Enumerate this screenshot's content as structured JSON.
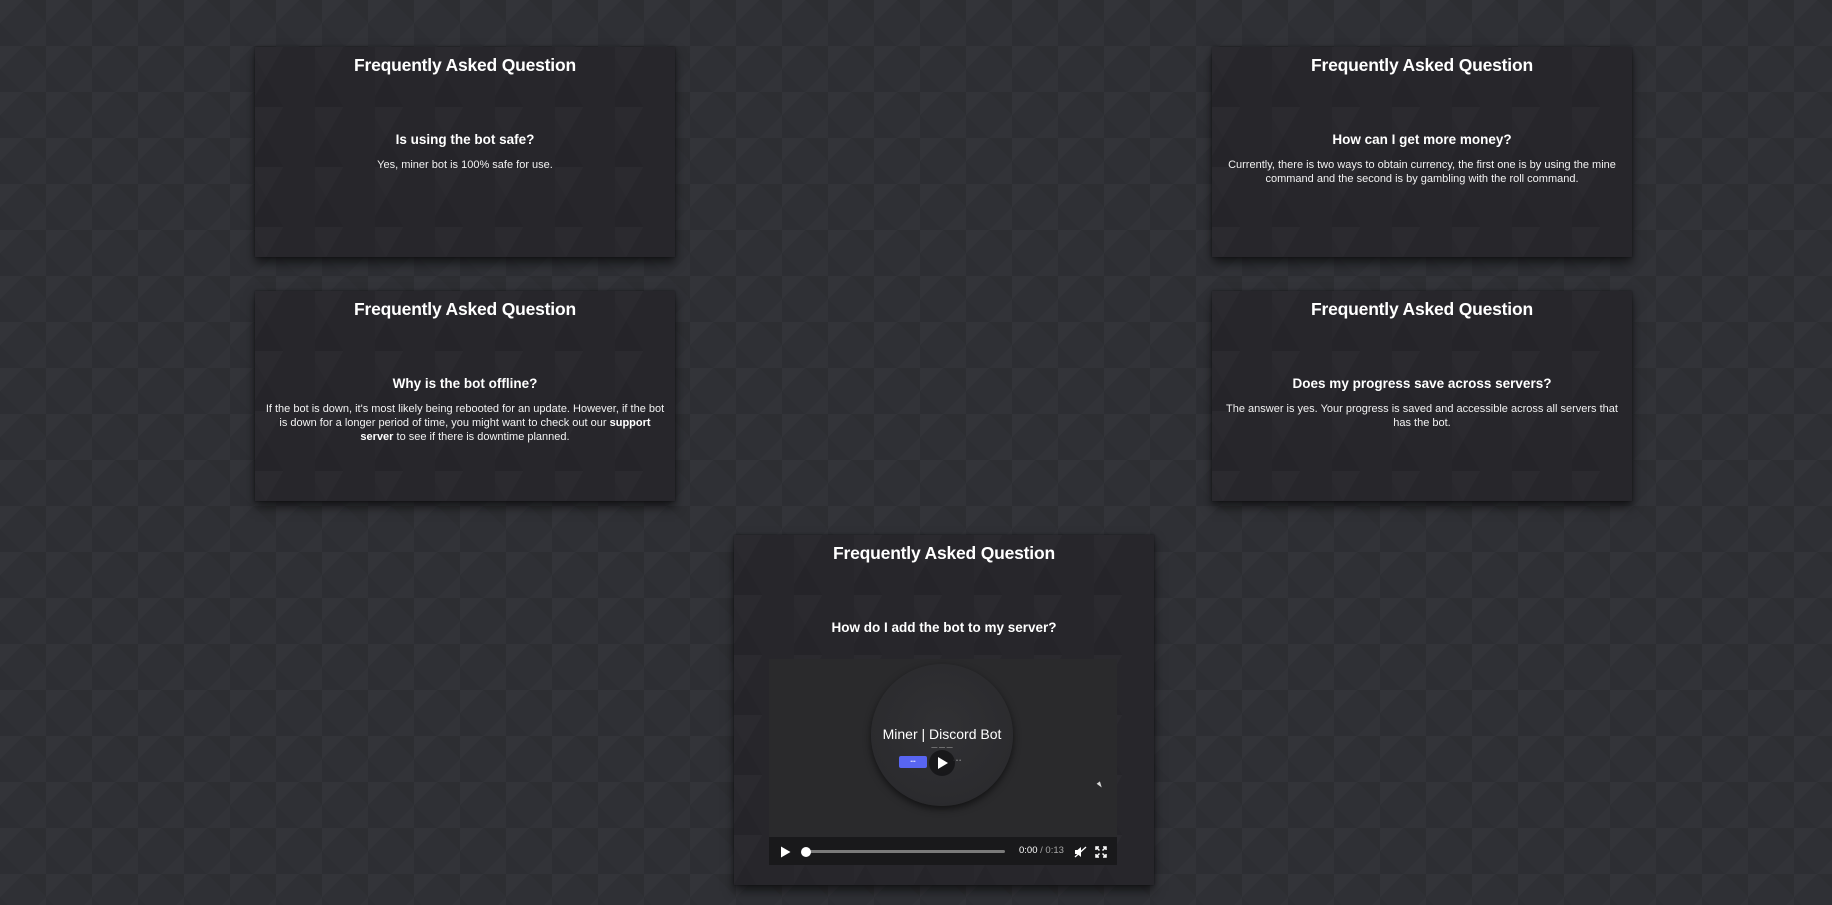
{
  "faq_cards": [
    {
      "title": "Frequently Asked Question",
      "question": "Is using the bot safe?",
      "answer": "Yes, miner bot is 100% safe for use."
    },
    {
      "title": "Frequently Asked Question",
      "question": "How can I get more money?",
      "answer": "Currently, there is two ways to obtain currency, the first one is by using the mine command and the second is by gambling with the roll command."
    },
    {
      "title": "Frequently Asked Question",
      "question": "Why is the bot offline?",
      "answer_before_link": "If the bot is down, it's most likely being rebooted for an update. However, if the bot is down for a longer period of time, you might want to check out our",
      "answer_link": "support server",
      "answer_after_link": "to see if there is downtime planned."
    },
    {
      "title": "Frequently Asked Question",
      "question": "Does my progress save across servers?",
      "answer": "The answer is yes. Your progress is saved and accessible across all servers that has the bot."
    },
    {
      "title": "Frequently Asked Question",
      "question": "How do I add the bot to my server?"
    }
  ],
  "video": {
    "bot_name": "Miner | Discord Bot",
    "current_time": "0:00",
    "separator": "/",
    "duration": "0:13",
    "progress_fraction": 0,
    "icons": {
      "play": "play-icon",
      "mute": "volume-muted-icon",
      "fullscreen": "fullscreen-icon"
    }
  },
  "colors": {
    "page_background": "#2f3035",
    "card_background": "#27262b",
    "invite_button": "#5865f2"
  }
}
